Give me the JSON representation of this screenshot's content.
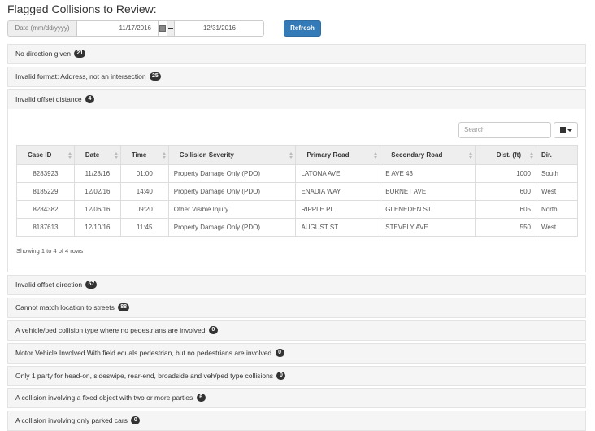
{
  "page": {
    "title": "Flagged Collisions to Review:"
  },
  "datebar": {
    "label": "Date (mm/dd/yyyy)",
    "start": "11/17/2016",
    "end": "12/31/2016",
    "refresh_label": "Refresh"
  },
  "panels": [
    {
      "label": "No direction given",
      "count": "21"
    },
    {
      "label": "Invalid format: Address, not an intersection",
      "count": "25"
    },
    {
      "label": "Invalid offset distance",
      "count": "4"
    },
    {
      "label": "Invalid offset direction",
      "count": "57"
    },
    {
      "label": "Cannot match location to streets",
      "count": "88"
    },
    {
      "label": "A vehicle/ped collision type where no pedestrians are involved",
      "count": "0"
    },
    {
      "label": "Motor Vehicle Involved With field equals pedestrian, but no pedestrians are involved",
      "count": "0"
    },
    {
      "label": "Only 1 party for head-on, sideswipe, rear-end, broadside and veh/ped type collisions",
      "count": "0"
    },
    {
      "label": "A collision involving a fixed object with two or more parties",
      "count": "6"
    },
    {
      "label": "A collision involving only parked cars",
      "count": "0"
    }
  ],
  "table": {
    "search_placeholder": "Search",
    "columns": [
      "Case ID",
      "Date",
      "Time",
      "Collision Severity",
      "Primary Road",
      "Secondary Road",
      "Dist. (ft)",
      "Dir."
    ],
    "rows": [
      [
        "8283923",
        "11/28/16",
        "01:00",
        "Property Damage Only (PDO)",
        "LATONA AVE",
        "E AVE 43",
        "1000",
        "South"
      ],
      [
        "8185229",
        "12/02/16",
        "14:40",
        "Property Damage Only (PDO)",
        "ENADIA WAY",
        "BURNET AVE",
        "600",
        "West"
      ],
      [
        "8284382",
        "12/06/16",
        "09:20",
        "Other Visible Injury",
        "RIPPLE PL",
        "GLENEDEN ST",
        "605",
        "North"
      ],
      [
        "8187613",
        "12/10/16",
        "11:45",
        "Property Damage Only (PDO)",
        "AUGUST ST",
        "STEVELY AVE",
        "550",
        "West"
      ]
    ],
    "showing": "Showing 1 to 4 of 4 rows"
  }
}
